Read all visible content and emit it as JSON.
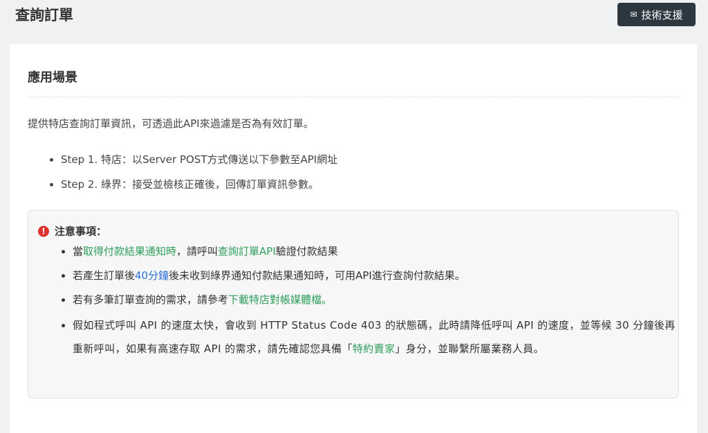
{
  "header": {
    "title": "查詢訂單",
    "support_icon": "✉",
    "support_label": "技術支援"
  },
  "section": {
    "title": "應用場景",
    "intro": "提供特店查詢訂單資訊，可透過此API來過濾是否為有效訂單。",
    "steps": [
      "Step 1. 特店：以Server POST方式傳送以下參數至API網址",
      "Step 2. 綠界：接受並檢核正確後，回傳訂單資訊參數。"
    ]
  },
  "notice": {
    "title": "注意事項：",
    "item1": {
      "pre": "當",
      "link1": "取得付款結果通知時",
      "mid": "，請呼叫",
      "link2": "查詢訂單API",
      "post": "驗證付款結果"
    },
    "item2": {
      "pre": "若產生訂單後",
      "highlight": "40分鐘",
      "post": "後未收到綠界通知付款結果通知時，可用API進行查詢付款結果。"
    },
    "item3": {
      "pre": "若有多筆訂單查詢的需求，請參考",
      "link": "下載特店對帳媒體檔",
      "post": "。"
    },
    "item4": {
      "pre": "假如程式呼叫 API 的速度太快，會收到 HTTP Status Code 403 的狀態碼，此時請降低呼叫 API 的速度，並等候 30 分鐘後再重新呼叫，如果有高速存取 API 的需求，請先確認您具備「",
      "link": "特約賣家",
      "post": "」身分，並聯繫所屬業務人員。"
    }
  },
  "colors": {
    "link_green": "#2e9e5b",
    "highlight_blue": "#2a6fd6",
    "warning_red": "#e03131",
    "button_bg": "#2d3740"
  }
}
